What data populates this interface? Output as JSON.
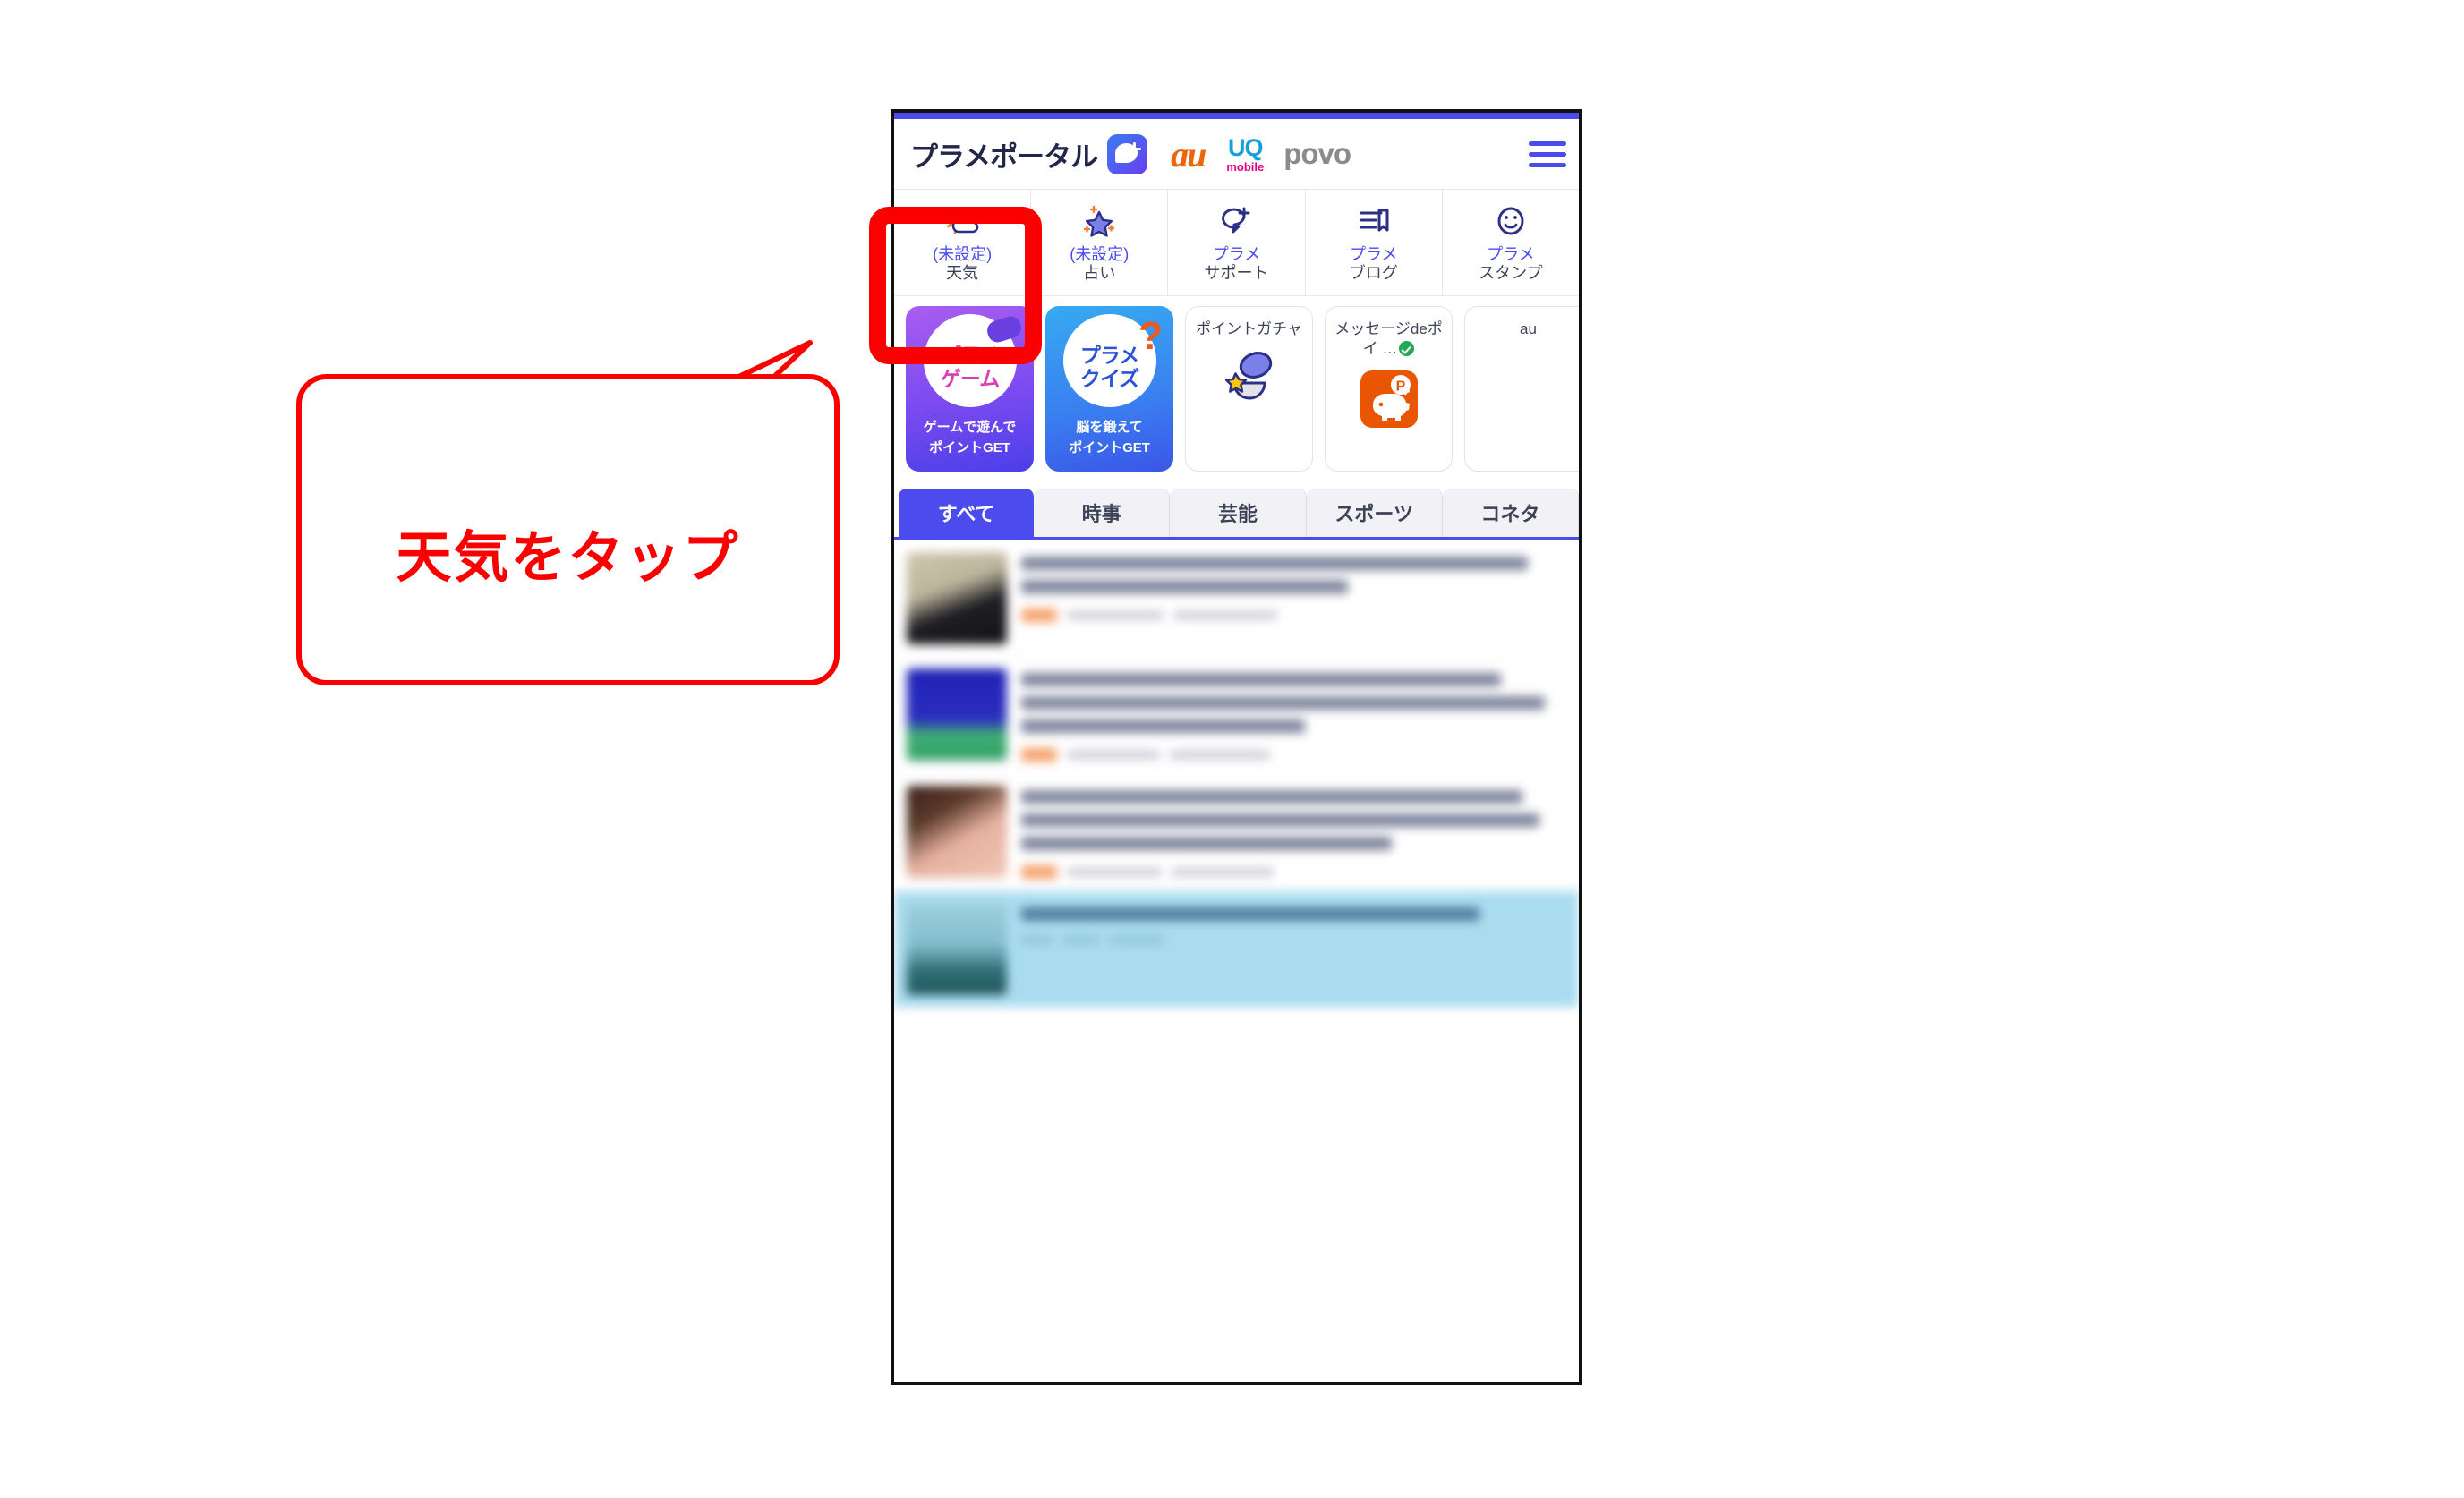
{
  "annotation": {
    "callout_text": "天気をタップ",
    "callout_color": "#fb0000",
    "highlight_target": "weather-quick-item"
  },
  "phone": {
    "header": {
      "title": "プラメポータル",
      "app_logo": "plamee-app-icon",
      "brand_logos": [
        {
          "name": "au",
          "text": "au",
          "color": "#ec6608"
        },
        {
          "name": "uq-mobile",
          "text_top": "UQ",
          "text_bottom": "mobile",
          "color_top": "#179fdb",
          "color_bottom": "#e4007f"
        },
        {
          "name": "povo",
          "text": "povo",
          "color": "#8b8b8b"
        }
      ],
      "menu": "hamburger-menu"
    },
    "quick_items": [
      {
        "icon": "weather-sun-cloud-icon",
        "line1": "(未設定)",
        "line2": "天気",
        "highlighted": true
      },
      {
        "icon": "fortune-star-icon",
        "line1": "(未設定)",
        "line2": "占い",
        "highlighted": false
      },
      {
        "icon": "support-chat-icon",
        "line1": "プラメ",
        "line2": "サポート",
        "highlighted": false
      },
      {
        "icon": "blog-document-icon",
        "line1": "プラメ",
        "line2": "ブログ",
        "highlighted": false
      },
      {
        "icon": "stamp-smiley-icon",
        "line1": "プラメ",
        "line2": "スタンプ",
        "highlighted": false
      }
    ],
    "promo_cards": [
      {
        "type": "gradient-purple",
        "title_line1": "プラメ",
        "title_line2": "ゲーム",
        "sub_line1": "ゲームで遊んで",
        "sub_line2": "ポイントGET",
        "icon": "gamepad-icon"
      },
      {
        "type": "gradient-blue",
        "title_line1": "プラメ",
        "title_line2": "クイズ",
        "sub_line1": "脳を鍛えて",
        "sub_line2": "ポイントGET",
        "icon": "question-mark-icon"
      },
      {
        "type": "plain",
        "label": "ポイントガチャ",
        "icon": "gacha-capsule-icon",
        "verified": false
      },
      {
        "type": "plain",
        "label": "メッセージdeポイ …",
        "icon": "piggy-bank-point-icon",
        "verified": true
      },
      {
        "type": "plain",
        "label": "au",
        "icon": "",
        "verified": false
      }
    ],
    "tabs": [
      {
        "label": "すべて",
        "active": true
      },
      {
        "label": "時事",
        "active": false
      },
      {
        "label": "芸能",
        "active": false
      },
      {
        "label": "スポーツ",
        "active": false
      },
      {
        "label": "コネタ",
        "active": false
      }
    ],
    "news_items": [
      {
        "thumb_color_a": "#cfc6ae",
        "thumb_color_b": "#1d1d22",
        "lines": 2,
        "highlighted": false
      },
      {
        "thumb_color_a": "#1f22b4",
        "thumb_color_b": "#3fae72",
        "lines": 3,
        "highlighted": false
      },
      {
        "thumb_color_a": "#3a211a",
        "thumb_color_b": "#e6b0a0",
        "lines": 3,
        "highlighted": false
      },
      {
        "thumb_color_a": "#9fd0dd",
        "thumb_color_b": "#2d6b72",
        "lines": 1,
        "highlighted": true
      }
    ]
  }
}
